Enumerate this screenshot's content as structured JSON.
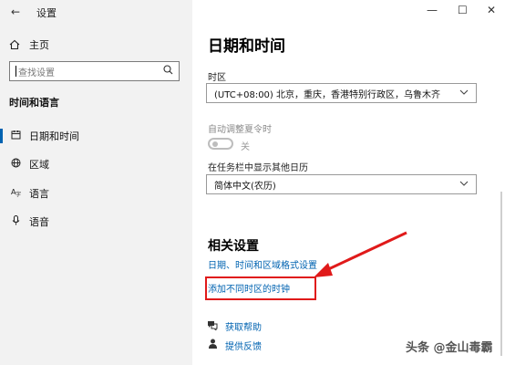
{
  "window": {
    "title": "设置",
    "back_icon": "←",
    "minimize": "—",
    "maximize": "☐",
    "close": "✕"
  },
  "sidebar": {
    "home_label": "主页",
    "search_placeholder": "查找设置",
    "section_title": "时间和语言",
    "items": [
      {
        "label": "日期和时间",
        "icon": "calendar-icon",
        "active": true
      },
      {
        "label": "区域",
        "icon": "globe-icon",
        "active": false
      },
      {
        "label": "语言",
        "icon": "language-icon",
        "active": false
      },
      {
        "label": "语音",
        "icon": "microphone-icon",
        "active": false
      }
    ]
  },
  "main": {
    "title": "日期和时间",
    "timezone_label": "时区",
    "timezone_value": "(UTC+08:00) 北京，重庆，香港特别行政区，乌鲁木齐",
    "dst_label": "自动调整夏令时",
    "dst_state": "关",
    "calendar_label": "在任务栏中显示其他日历",
    "calendar_value": "简体中文(农历)",
    "related_title": "相关设置",
    "related_links": [
      "日期、时间和区域格式设置",
      "添加不同时区的时钟"
    ],
    "help_link": "获取帮助",
    "feedback_link": "提供反馈"
  },
  "watermark": "头条 @金山毒霸",
  "colors": {
    "accent": "#0063b1",
    "highlight": "#e01a1a"
  }
}
